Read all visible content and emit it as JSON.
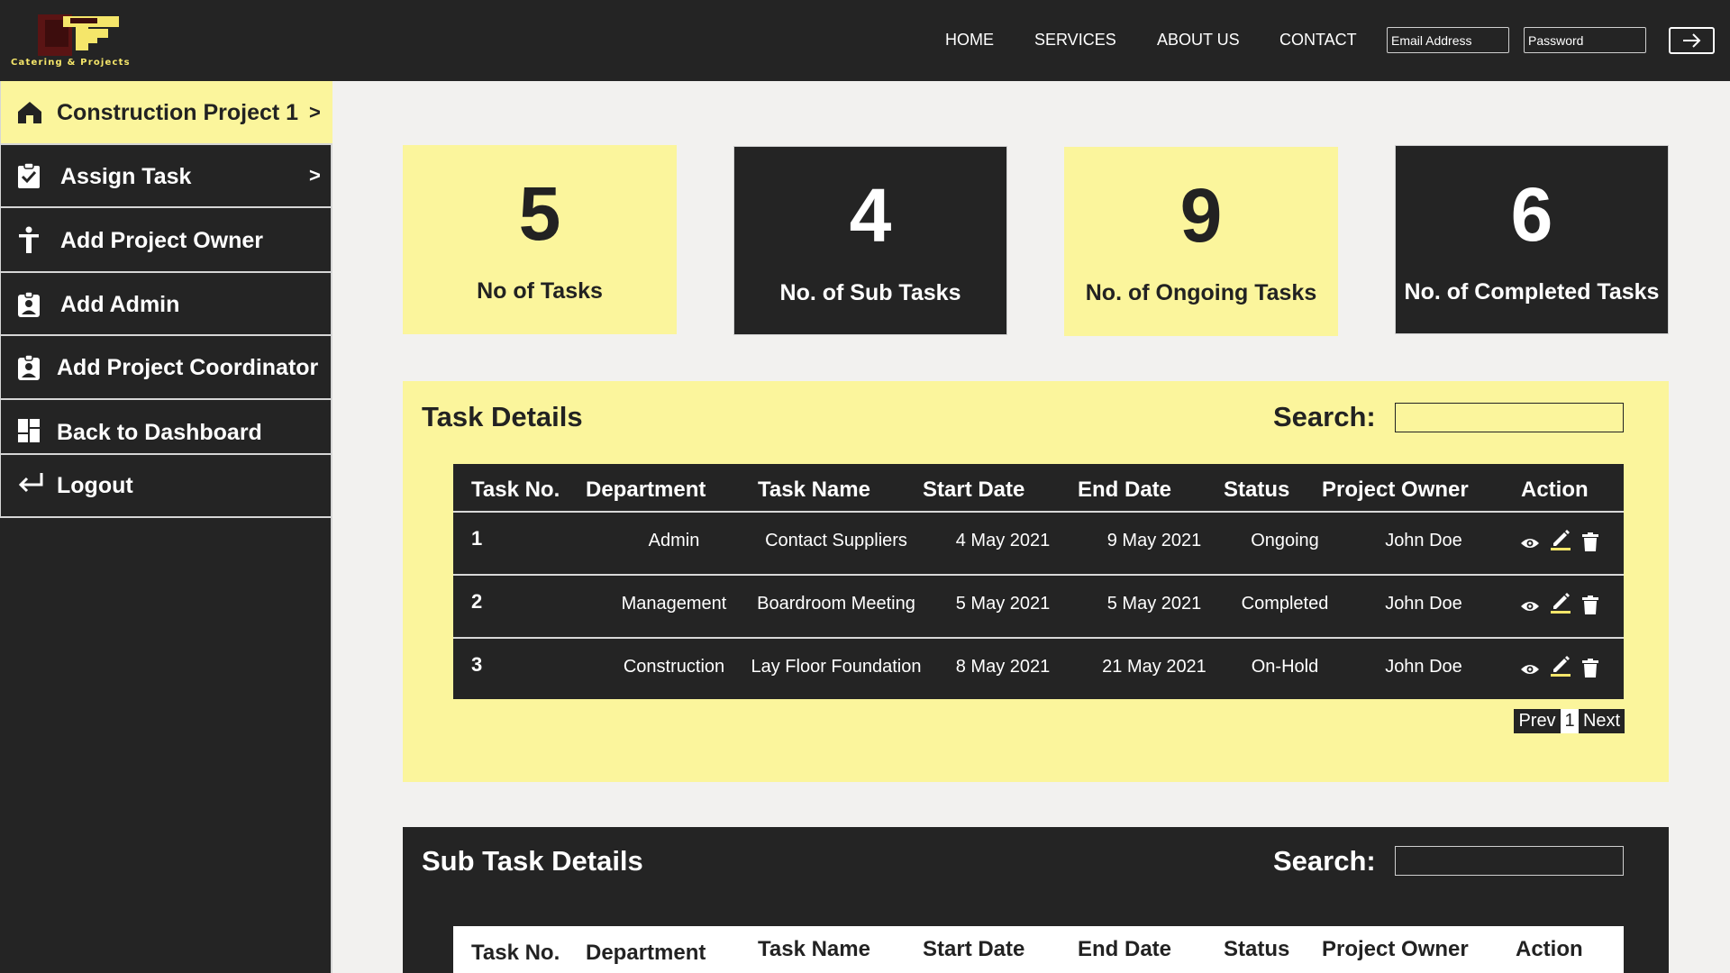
{
  "brand": {
    "logo_text": "Catering & Projects"
  },
  "nav": {
    "home": "HOME",
    "services": "SERVICES",
    "about": "ABOUT US",
    "contact": "CONTACT"
  },
  "login": {
    "email_placeholder": "Email Address",
    "password_placeholder": "Password"
  },
  "sidebar": {
    "items": [
      {
        "label": "Construction Project 1",
        "icon": "home-icon",
        "chevron": ">"
      },
      {
        "label": "Assign Task",
        "icon": "clipboard-check-icon",
        "chevron": ">"
      },
      {
        "label": "Add Project Owner",
        "icon": "person-icon"
      },
      {
        "label": "Add Admin",
        "icon": "badge-icon"
      },
      {
        "label": "Add Project Coordinator",
        "icon": "badge-icon"
      },
      {
        "label": "Back to Dashboard",
        "icon": "dashboard-icon"
      },
      {
        "label": "Logout",
        "icon": "logout-arrow-icon"
      }
    ]
  },
  "stats": [
    {
      "value": "5",
      "label": "No of Tasks"
    },
    {
      "value": "4",
      "label": "No. of Sub Tasks"
    },
    {
      "value": "9",
      "label": "No. of Ongoing Tasks"
    },
    {
      "value": "6",
      "label": "No. of Completed Tasks"
    }
  ],
  "task_details": {
    "title": "Task Details",
    "search_label": "Search:",
    "columns": [
      "Task No.",
      "Department",
      "Task Name",
      "Start Date",
      "End Date",
      "Status",
      "Project Owner",
      "Action"
    ],
    "rows": [
      {
        "no": "1",
        "department": "Admin",
        "task_name": "Contact Suppliers",
        "start": "4 May 2021",
        "end": "9 May 2021",
        "status": "Ongoing",
        "owner": "John Doe"
      },
      {
        "no": "2",
        "department": "Management",
        "task_name": "Boardroom Meeting",
        "start": "5 May 2021",
        "end": "5 May 2021",
        "status": "Completed",
        "owner": "John Doe"
      },
      {
        "no": "3",
        "department": "Construction",
        "task_name": "Lay Floor Foundation",
        "start": "8 May 2021",
        "end": "21 May 2021",
        "status": "On-Hold",
        "owner": "John Doe"
      }
    ],
    "pager": {
      "prev": "Prev",
      "page": "1",
      "next": "Next"
    }
  },
  "sub_task_details": {
    "title": "Sub Task Details",
    "search_label": "Search:",
    "columns": [
      "Task No.",
      "Department",
      "Task Name",
      "Start Date",
      "End Date",
      "Status",
      "Project Owner",
      "Action"
    ]
  },
  "colors": {
    "dark": "#242424",
    "accent_yellow": "#fbf59c",
    "logo_yellow": "#f5e66a",
    "logo_maroon": "#5a1414"
  }
}
